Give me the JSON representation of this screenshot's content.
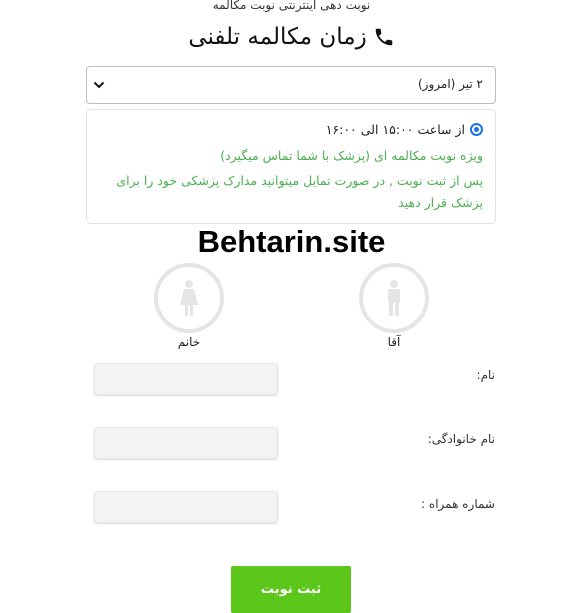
{
  "header": {
    "subtitle": "نوبت دهی اینترنتی نوبت مکالمه",
    "title": "زمان مکالمه تلفنی",
    "title_icon": "phone-icon"
  },
  "date_select": {
    "selected": "۲ تیر (امروز)",
    "icon": "chevron-down-icon"
  },
  "slot": {
    "selected": true,
    "time_text": "از ساعت ۱۵:۰۰ الی ۱۶:۰۰",
    "note": "ویژه نوبت مکالمه ای (پزشک با شما تماس میگیرد)",
    "description": "پس از ثبت نوبت , در صورت تمایل میتوانید مدارک پزشکی خود را برای پزشک قرار دهید",
    "accent_color": "#4caf50"
  },
  "watermark": "Behtarin.site",
  "gender": {
    "male_label": "آقا",
    "female_label": "خانم",
    "male_icon": "male-icon",
    "female_icon": "female-icon"
  },
  "form": {
    "first_name_label": "نام:",
    "last_name_label": "نام خانوادگی:",
    "phone_label": "شماره همراه :",
    "first_name_value": "",
    "last_name_value": "",
    "phone_value": ""
  },
  "submit_label": "ثبت نوبت",
  "colors": {
    "submit_bg": "#5cc61a",
    "radio": "#1a73e8"
  }
}
